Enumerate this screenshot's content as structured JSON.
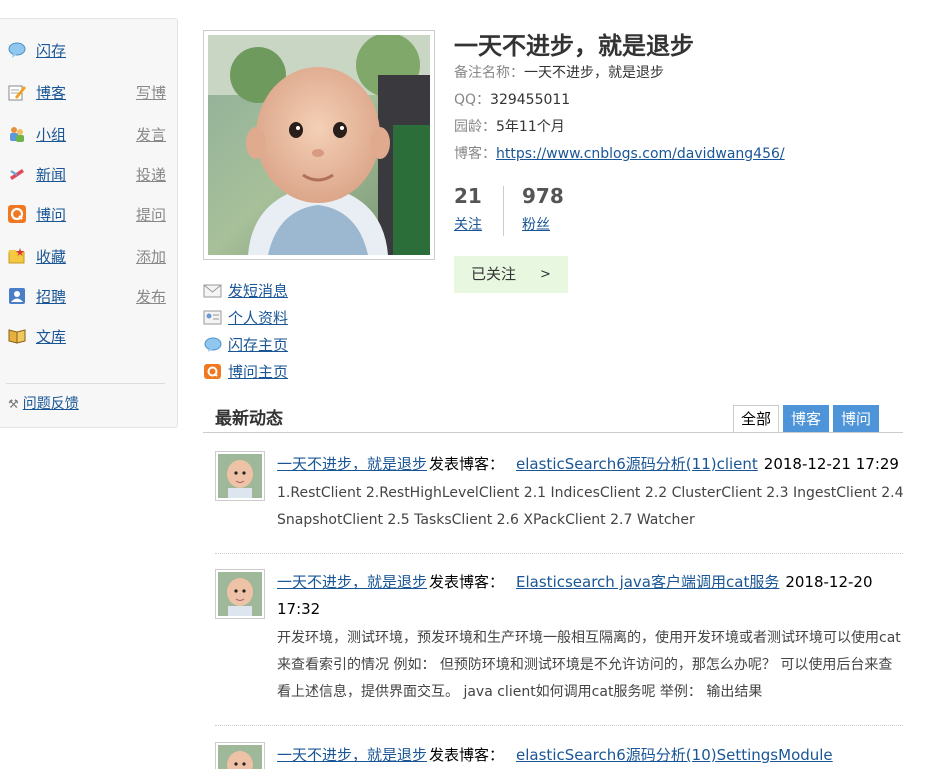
{
  "sidebar": {
    "items": [
      {
        "label": "闪存",
        "action": "",
        "icon": "speech-bubble-icon"
      },
      {
        "label": "博客",
        "action": "写博",
        "icon": "notepad-pencil-icon"
      },
      {
        "label": "小组",
        "action": "发言",
        "icon": "group-people-icon"
      },
      {
        "label": "新闻",
        "action": "投递",
        "icon": "news-icon"
      },
      {
        "label": "博问",
        "action": "提问",
        "icon": "q-icon"
      },
      {
        "label": "收藏",
        "action": "添加",
        "icon": "folder-star-icon"
      },
      {
        "label": "招聘",
        "action": "发布",
        "icon": "person-card-icon"
      },
      {
        "label": "文库",
        "action": "",
        "icon": "book-icon"
      }
    ],
    "feedback_label": "问题反馈"
  },
  "profile": {
    "display_name": "一天不进步，就是退步",
    "fields": [
      {
        "key": "备注名称：",
        "value": "一天不进步，就是退步"
      },
      {
        "key": "QQ：",
        "value": "329455011"
      },
      {
        "key": "园龄：",
        "value": "5年11个月"
      },
      {
        "key": "博客：",
        "value": "https://www.cnblogs.com/davidwang456/"
      }
    ],
    "following_count": "21",
    "following_label": "关注",
    "followers_count": "978",
    "followers_label": "粉丝",
    "follow_button": "已关注",
    "follow_arrow": ">",
    "links": [
      "发短消息",
      "个人资料",
      "闪存主页",
      "博问主页"
    ]
  },
  "feed": {
    "title": "最新动态",
    "tabs": [
      "全部",
      "博客",
      "博问"
    ],
    "entries": [
      {
        "author": "一天不进步，就是退步",
        "verb": "发表博客：",
        "post_title": "elasticSearch6源码分析(11)client",
        "time": "2018-12-21 17:29",
        "summary": "1.RestClient 2.RestHighLevelClient 2.1 IndicesClient 2.2 ClusterClient 2.3 IngestClient 2.4 SnapshotClient 2.5 TasksClient 2.6 XPackClient 2.7 Watcher"
      },
      {
        "author": "一天不进步，就是退步",
        "verb": "发表博客：",
        "post_title": "Elasticsearch java客户端调用cat服务",
        "time": "2018-12-20 17:32",
        "summary": "开发环境，测试环境，预发环境和生产环境一般相互隔离的，使用开发环境或者测试环境可以使用cat来查看索引的情况 例如： 但预防环境和测试环境是不允许访问的，那怎么办呢？ 可以使用后台来查看上述信息，提供界面交互。 java client如何调用cat服务呢 举例： 输出结果"
      },
      {
        "author": "一天不进步，就是退步",
        "verb": "发表博客：",
        "post_title": "elasticSearch6源码分析(10)SettingsModule",
        "time": "",
        "summary": ""
      }
    ]
  },
  "colors": {
    "link": "#1a5696",
    "tab_blue": "#4e94d8",
    "follow_bg": "#e8f7e0"
  }
}
